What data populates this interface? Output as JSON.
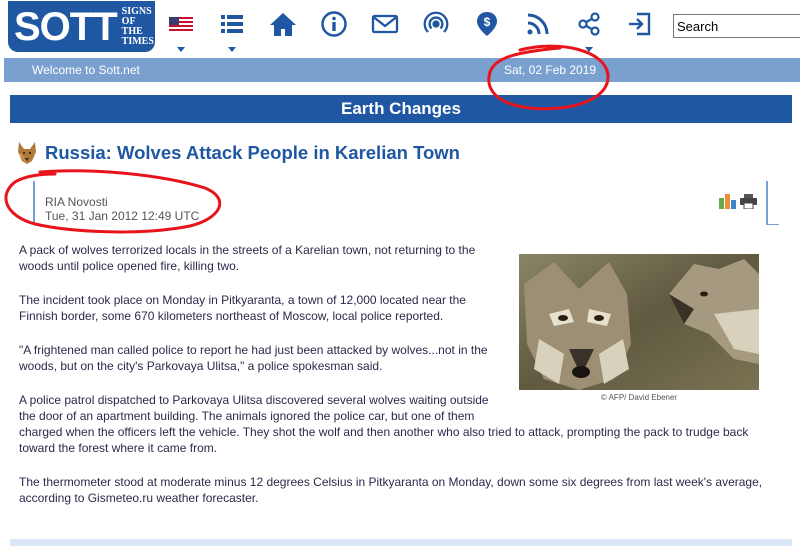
{
  "header": {
    "logo_word": "SOTT",
    "logo_tag": [
      "SIGNS",
      "OF THE",
      "TIMES"
    ],
    "nav_icons": [
      "us-flag-icon",
      "list-menu-icon",
      "home-icon",
      "info-icon",
      "mail-icon",
      "podcast-icon",
      "donate-icon",
      "rss-icon",
      "share-icon",
      "login-icon"
    ],
    "search": {
      "placeholder": "Search"
    }
  },
  "welcome_bar": {
    "welcome": "Welcome to Sott.net",
    "date": "Sat, 02 Feb 2019"
  },
  "section": {
    "title": "Earth Changes"
  },
  "article": {
    "title": "Russia: Wolves Attack People in Karelian Town",
    "source": "RIA Novosti",
    "published": "Tue, 31 Jan 2012 12:49 UTC",
    "paragraphs": [
      "A pack of wolves terrorized locals in the streets of a Karelian town, not returning to the woods until police opened fire, killing two.",
      "The incident took place on Monday in Pitkyaranta, a town of 12,000 located near the Finnish border, some 670 kilometers northeast of Moscow, local police reported.",
      "\"A frightened man called police to report he had just been attacked by wolves...not in the woods, but on the city's Parkovaya Ulitsa,\" a police spokesman said.",
      "A police patrol dispatched to Parkovaya Ulitsa discovered several wolves waiting outside the door of an apartment building. The animals ignored the police car, but one of them",
      "charged when the officers left the vehicle. They shot the wolf and then another who also tried to attack, prompting the pack to trudge back toward the forest where it came from.",
      "The thermometer stood at moderate minus 12 degrees Celsius in Pitkyaranta on Monday, down some six degrees from last week's average, according to Gismeteo.ru weather forecaster."
    ],
    "photo_caption": "© AFP/ David Ebener"
  },
  "colors": {
    "brand_blue": "#1f57a3",
    "bar_blue": "#7aa0cf",
    "annotation_red": "#e8141c"
  }
}
